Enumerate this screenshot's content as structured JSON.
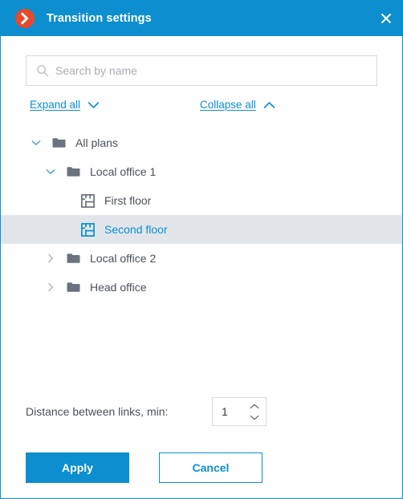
{
  "window": {
    "title": "Transition settings",
    "logo_icon": "orange-chevron-right-logo",
    "close_icon": "close-icon",
    "accent_color": "#0d8ecf",
    "logo_color": "#e8492a",
    "selection_color": "#e2e6ea"
  },
  "search": {
    "icon": "search-icon",
    "value": "",
    "placeholder": "Search by name"
  },
  "tree_links": {
    "expand": {
      "label": "Expand all",
      "icon": "chevron-down-icon"
    },
    "collapse": {
      "label": "Collapse all",
      "icon": "chevron-up-icon"
    }
  },
  "tree": {
    "nodes": [
      {
        "label": "All plans",
        "icon": "folder-icon",
        "twisty": "chevron-down-icon",
        "level": 0,
        "expanded": true,
        "selected": false
      },
      {
        "label": "Local office 1",
        "icon": "folder-icon",
        "twisty": "chevron-down-icon",
        "level": 1,
        "expanded": true,
        "selected": false
      },
      {
        "label": "First floor",
        "icon": "floor-plan-icon",
        "twisty": "",
        "level": 2,
        "expanded": false,
        "selected": false
      },
      {
        "label": "Second floor",
        "icon": "floor-plan-icon",
        "twisty": "",
        "level": 2,
        "expanded": false,
        "selected": true
      },
      {
        "label": "Local office 2",
        "icon": "folder-icon",
        "twisty": "chevron-right-icon",
        "level": 1,
        "expanded": false,
        "selected": false
      },
      {
        "label": "Head office",
        "icon": "folder-icon",
        "twisty": "chevron-right-icon",
        "level": 1,
        "expanded": false,
        "selected": false
      }
    ]
  },
  "distance": {
    "label": "Distance between links, min:",
    "value": "1",
    "increment_icon": "caret-up-icon",
    "decrement_icon": "caret-down-icon"
  },
  "footer": {
    "apply_label": "Apply",
    "cancel_label": "Cancel"
  }
}
